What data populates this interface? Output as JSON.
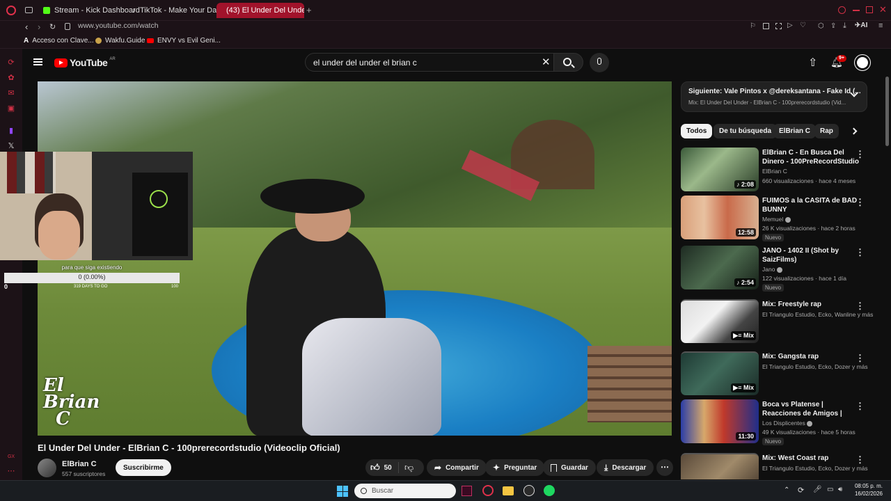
{
  "browser": {
    "tabs": [
      {
        "label": "Stream - Kick Dashboard",
        "icon": "kick-icon"
      },
      {
        "label": "TikTok - Make Your Day",
        "icon": "tiktok-icon"
      },
      {
        "label": "(43) El Under Del Unde",
        "icon": "youtube-icon",
        "active": true
      }
    ],
    "url": "www.youtube.com/watch",
    "bookmarks": [
      {
        "label": "Acceso con Clave...",
        "icon": "a-icon"
      },
      {
        "label": "Wakfu.Guide",
        "icon": "wakfu-icon"
      },
      {
        "label": "ENVY vs Evil Geni...",
        "icon": "youtube-icon"
      }
    ],
    "ai_label": "AI"
  },
  "youtube": {
    "logo_text": "YouTube",
    "region": "AR",
    "search_value": "el under del under el brian c",
    "notifications_count": "9+"
  },
  "overlay": {
    "goal_label": "para que siga existiendo",
    "goal_progress_text": "0 (0.00%)",
    "goal_days": "319 DAYS TO GO",
    "goal_min": "0",
    "goal_max": "100",
    "goal_fraction": 0.0
  },
  "video": {
    "watermark": "El Brian C",
    "title": "El Under Del Under - ElBrian C - 100prerecordstudio (Videoclip Oficial)",
    "channel": "ElBrian C",
    "subscribers": "557 suscriptores",
    "subscribe_label": "Suscribirme",
    "likes": "50",
    "share_label": "Compartir",
    "ask_label": "Preguntar",
    "save_label": "Guardar",
    "download_label": "Descargar"
  },
  "upnext": {
    "title": "Siguiente: Vale Pintos x @dereksantana - Fake Id (...",
    "subtitle": "Mix: El Under Del Under - ElBrian C - 100prerecordstudio (Vid..."
  },
  "chips": [
    "Todos",
    "De tu búsqueda",
    "ElBrian C",
    "Rap"
  ],
  "recommendations": [
    {
      "title": "ElBrian C - En Busca Del Dinero - 100PreRecordStudio",
      "channel": "ElBrian C",
      "meta": "660 visualizaciones · hace 4 meses",
      "duration": "2:08",
      "badge": "",
      "verified": false
    },
    {
      "title": "FUIMOS a la CASITA de BAD BUNNY",
      "channel": "Memuel",
      "meta": "26 K visualizaciones · hace 2 horas",
      "duration": "12:58",
      "badge": "Nuevo",
      "verified": true
    },
    {
      "title": "JANO - 1402 II (Shot by SaizFilms)",
      "channel": "Jano",
      "meta": "122 visualizaciones · hace 1 día",
      "duration": "2:54",
      "badge": "Nuevo",
      "verified": true
    },
    {
      "title": "Mix: Freestyle rap",
      "channel": "El Triangulo Estudio, Ecko, Wanline y más",
      "meta": "",
      "duration": "Mix",
      "badge": "",
      "verified": false
    },
    {
      "title": "Mix: Gangsta rap",
      "channel": "El Triangulo Estudio, Ecko, Dozer y más",
      "meta": "",
      "duration": "Mix",
      "badge": "",
      "verified": false
    },
    {
      "title": "Boca vs Platense | Reacciones de Amigos | Torneo Apertura ...",
      "channel": "Los Displicentes",
      "meta": "49 K visualizaciones · hace 5 horas",
      "duration": "11:30",
      "badge": "Nuevo",
      "verified": true
    },
    {
      "title": "Mix: West Coast rap",
      "channel": "El Triangulo Estudio, Ecko, Dozer y más",
      "meta": "",
      "duration": "",
      "badge": "",
      "verified": false
    }
  ],
  "taskbar": {
    "search_placeholder": "Buscar",
    "time": "08:05 p. m.",
    "date": "16/02/2026"
  }
}
